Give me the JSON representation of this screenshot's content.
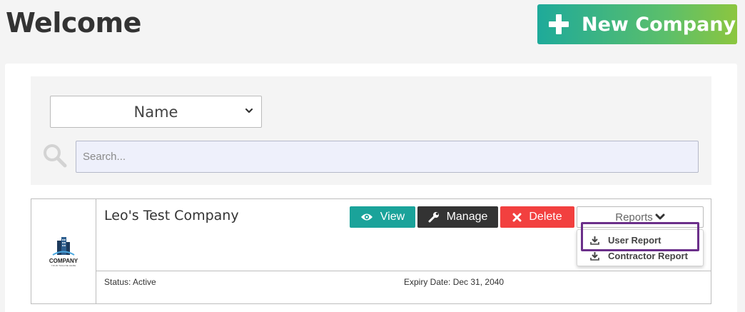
{
  "header": {
    "title": "Welcome",
    "new_company_label": "New Company"
  },
  "filter": {
    "sort_selected": "Name",
    "search_placeholder": "Search..."
  },
  "company": {
    "name": "Leo's Test Company",
    "logo_text": "COMPANY",
    "logo_subtext": "YOUR TAGLINE HERE",
    "actions": {
      "view": "View",
      "manage": "Manage",
      "delete": "Delete",
      "reports": "Reports"
    },
    "reports_menu": [
      "User Report",
      "Contractor Report"
    ],
    "status_label": "Status:",
    "status_value": "Active",
    "expiry_label": "Expiry Date:",
    "expiry_value": "Dec 31, 2040"
  },
  "colors": {
    "new_company_gradient_start": "#1eaa9a",
    "new_company_gradient_end": "#8cc63f",
    "view": "#1aa39a",
    "manage": "#333333",
    "delete": "#f2403f",
    "highlight": "#6b2f8a"
  },
  "icons": {
    "new_company": "plus-icon",
    "select": "chevron-down-icon",
    "search": "search-icon",
    "view": "eye-icon",
    "manage": "wrench-icon",
    "delete": "close-icon",
    "reports": "chevron-down-icon",
    "report_item": "download-icon"
  }
}
